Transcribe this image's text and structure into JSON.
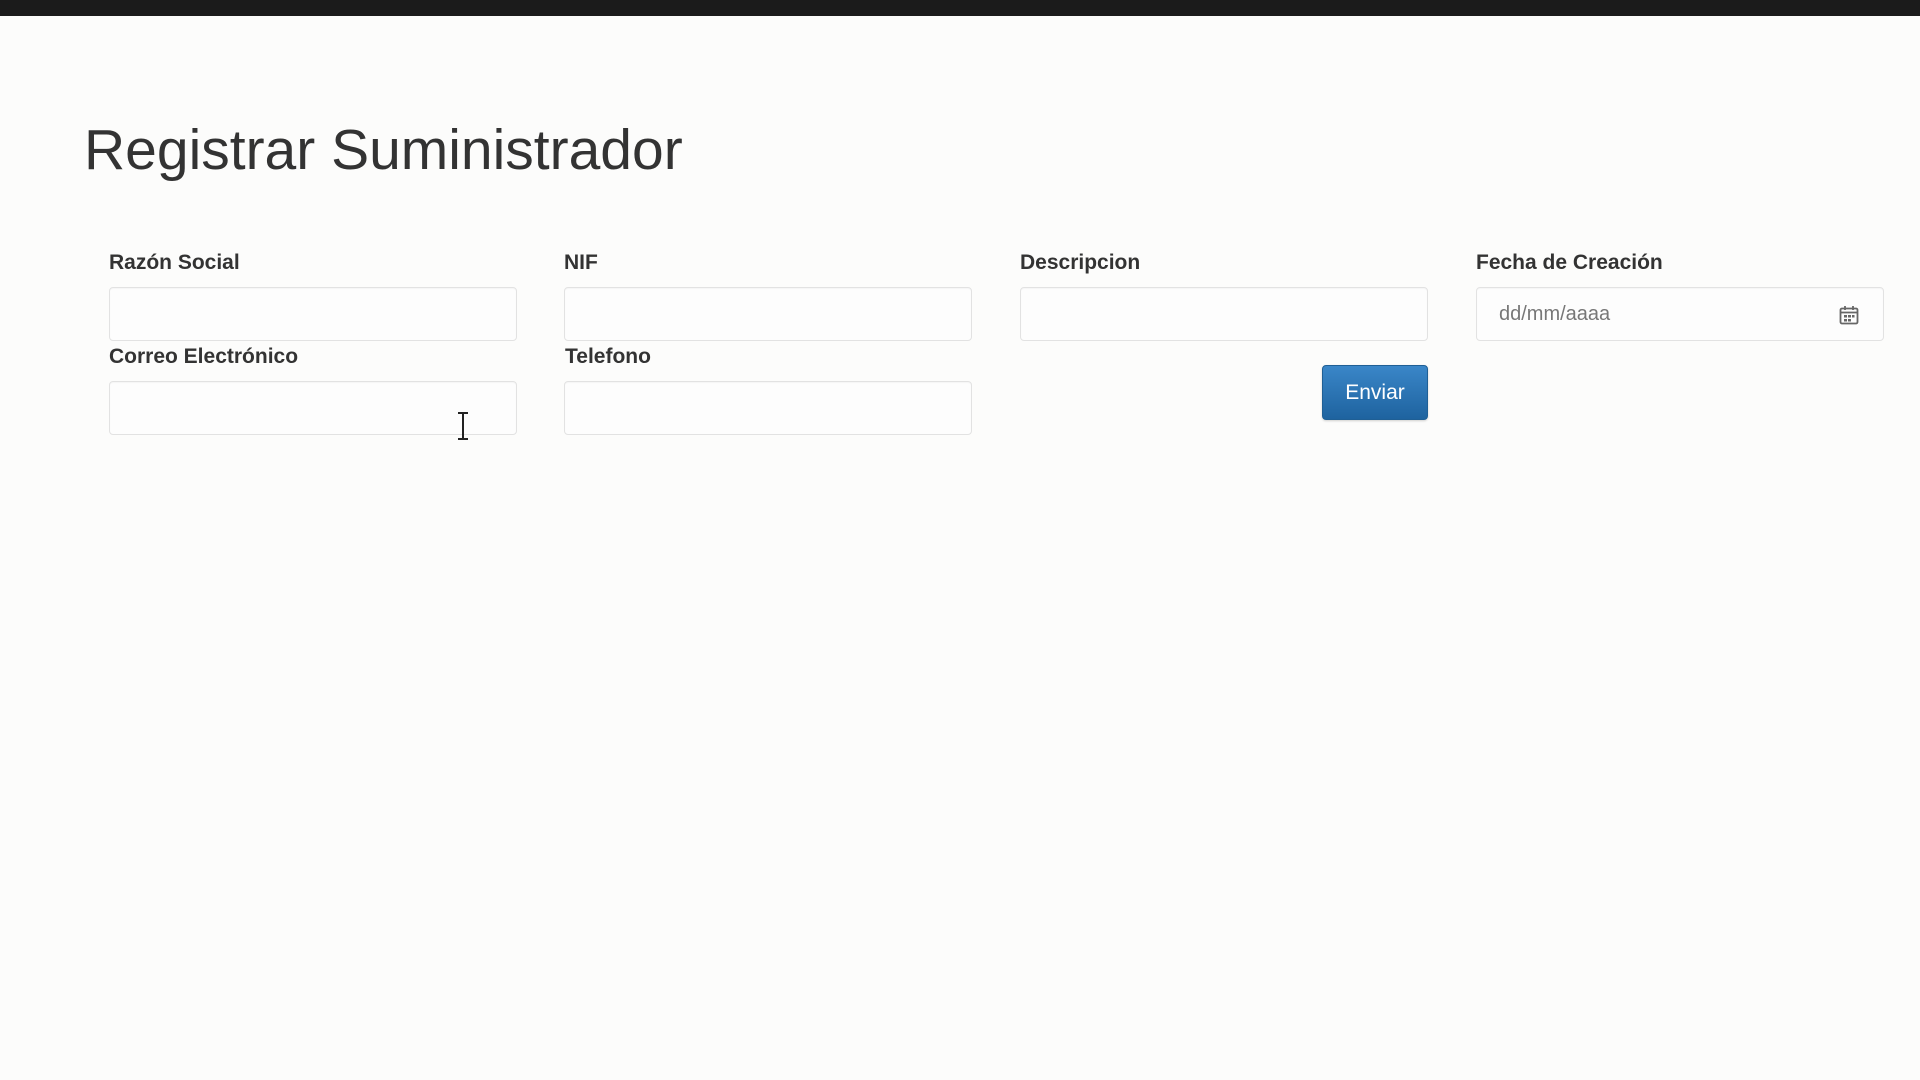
{
  "page": {
    "title": "Registrar Suministrador"
  },
  "form": {
    "fields": {
      "razon_social": {
        "label": "Razón Social",
        "value": ""
      },
      "nif": {
        "label": "NIF",
        "value": ""
      },
      "descripcion": {
        "label": "Descripcion",
        "value": ""
      },
      "fecha_creacion": {
        "label": "Fecha de Creación",
        "placeholder": "dd/mm/aaaa",
        "value": ""
      },
      "correo_electronico": {
        "label": "Correo Electrónico",
        "value": ""
      },
      "telefono": {
        "label": "Telefono",
        "value": ""
      }
    },
    "submit_label": "Enviar"
  },
  "icons": {
    "calendar": "calendar-icon",
    "cursor": "text-cursor-icon"
  },
  "colors": {
    "background": "#fcfcfb",
    "primary_button": "#2f78b8",
    "text": "#333333"
  }
}
